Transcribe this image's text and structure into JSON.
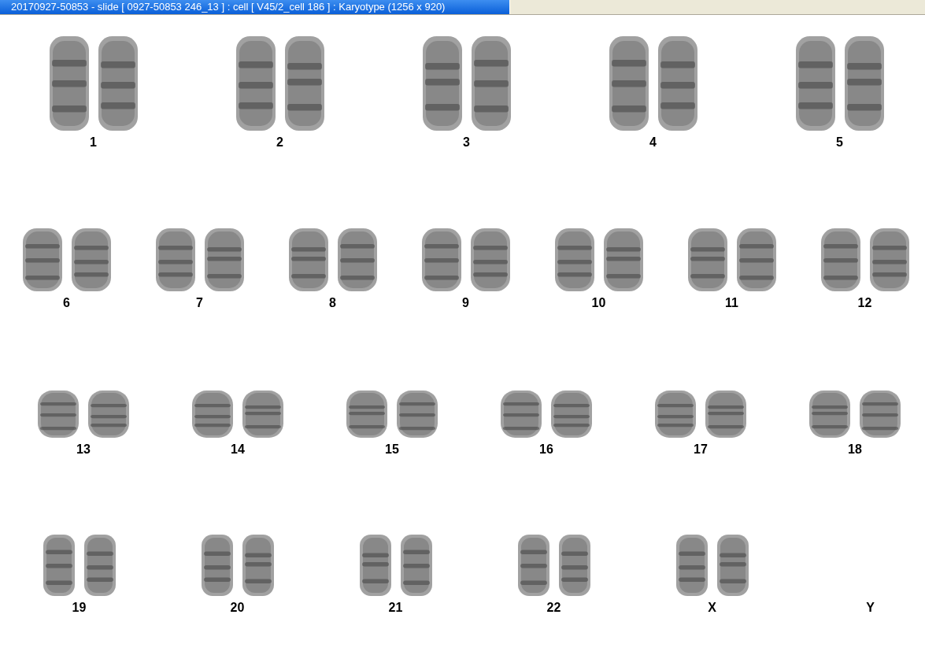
{
  "window": {
    "title": "20170927-50853 - slide [ 0927-50853 246_13 ] : cell [ V45/2_cell 186 ] : Karyotype  (1256 x 920)"
  },
  "karyotype": {
    "chromosomes": [
      {
        "label": "1",
        "kind": "pair"
      },
      {
        "label": "2",
        "kind": "pair"
      },
      {
        "label": "3",
        "kind": "pair"
      },
      {
        "label": "4",
        "kind": "pair"
      },
      {
        "label": "5",
        "kind": "pair"
      },
      {
        "label": "6",
        "kind": "pair"
      },
      {
        "label": "7",
        "kind": "pair"
      },
      {
        "label": "8",
        "kind": "pair"
      },
      {
        "label": "9",
        "kind": "pair"
      },
      {
        "label": "10",
        "kind": "pair"
      },
      {
        "label": "11",
        "kind": "pair"
      },
      {
        "label": "12",
        "kind": "pair"
      },
      {
        "label": "13",
        "kind": "pair"
      },
      {
        "label": "14",
        "kind": "pair"
      },
      {
        "label": "15",
        "kind": "pair"
      },
      {
        "label": "16",
        "kind": "pair"
      },
      {
        "label": "17",
        "kind": "pair"
      },
      {
        "label": "18",
        "kind": "pair"
      },
      {
        "label": "19",
        "kind": "pair"
      },
      {
        "label": "20",
        "kind": "pair"
      },
      {
        "label": "21",
        "kind": "pair"
      },
      {
        "label": "22",
        "kind": "pair"
      },
      {
        "label": "X",
        "kind": "pair"
      },
      {
        "label": "Y",
        "kind": "none"
      }
    ]
  }
}
